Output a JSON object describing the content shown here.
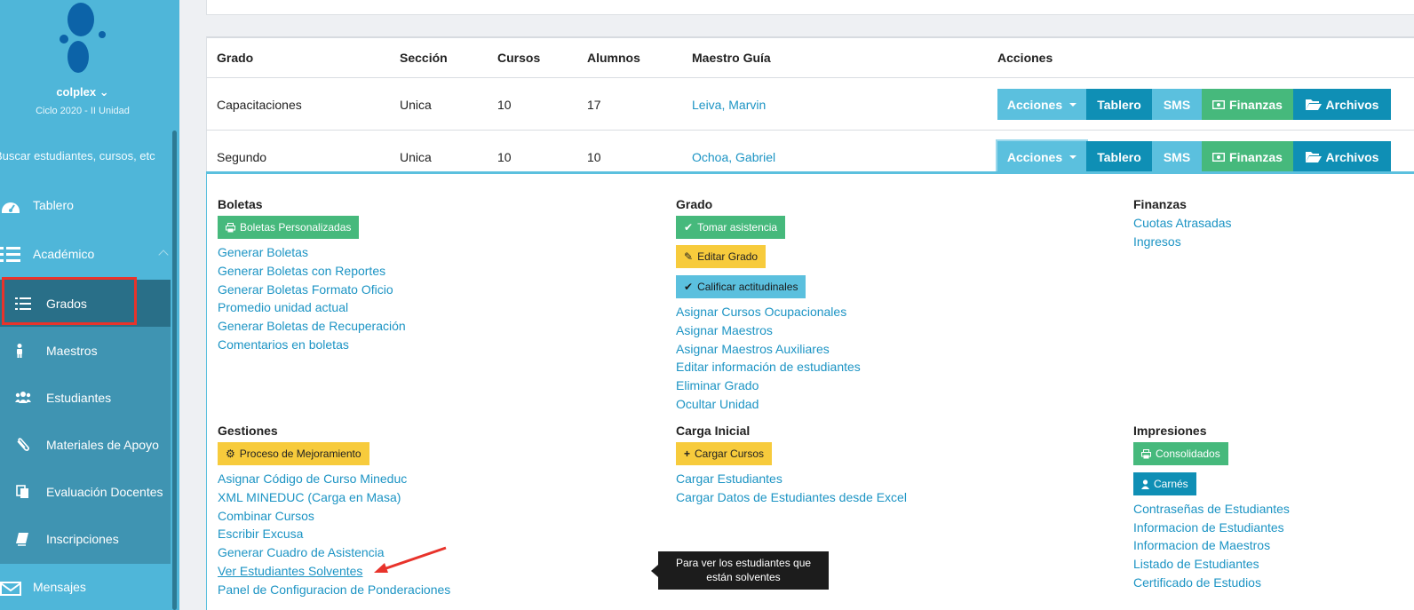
{
  "sidebar": {
    "brand": "colplex",
    "cycle": "Ciclo 2020 - II Unidad",
    "search_placeholder": "Buscar estudiantes, cursos, etc",
    "nav": {
      "tablero": "Tablero",
      "academico": "Académico",
      "mensajes": "Mensajes"
    },
    "sub": {
      "grados": "Grados",
      "maestros": "Maestros",
      "estudiantes": "Estudiantes",
      "materiales": "Materiales de Apoyo",
      "evaluacion": "Evaluación Docentes",
      "inscripciones": "Inscripciones"
    }
  },
  "table": {
    "headers": {
      "grado": "Grado",
      "seccion": "Sección",
      "cursos": "Cursos",
      "alumnos": "Alumnos",
      "maestro": "Maestro Guía",
      "acciones": "Acciones"
    },
    "rows": [
      {
        "grado": "Capacitaciones",
        "seccion": "Unica",
        "cursos": "10",
        "alumnos": "17",
        "maestro": "Leiva, Marvin"
      },
      {
        "grado": "Segundo",
        "seccion": "Unica",
        "cursos": "10",
        "alumnos": "10",
        "maestro": "Ochoa, Gabriel"
      }
    ],
    "buttons": {
      "acciones": "Acciones",
      "tablero": "Tablero",
      "sms": "SMS",
      "finanzas": "Finanzas",
      "archivos": "Archivos"
    }
  },
  "panel": {
    "boletas": {
      "title": "Boletas",
      "button": "Boletas Personalizadas",
      "links": [
        "Generar Boletas",
        "Generar Boletas con Reportes",
        "Generar Boletas Formato Oficio",
        "Promedio unidad actual",
        "Generar Boletas de Recuperación",
        "Comentarios en boletas"
      ]
    },
    "grado": {
      "title": "Grado",
      "btn_asistencia": "Tomar asistencia",
      "btn_editar": "Editar Grado",
      "btn_calificar": "Calificar actitudinales",
      "links": [
        "Asignar Cursos Ocupacionales",
        "Asignar Maestros",
        "Asignar Maestros Auxiliares",
        "Editar información de estudiantes",
        "Eliminar Grado",
        "Ocultar Unidad"
      ]
    },
    "finanzas": {
      "title": "Finanzas",
      "links": [
        "Cuotas Atrasadas",
        "Ingresos"
      ]
    },
    "gestiones": {
      "title": "Gestiones",
      "button": "Proceso de Mejoramiento",
      "links": [
        "Asignar Código de Curso Mineduc",
        "XML MINEDUC (Carga en Masa)",
        "Combinar Cursos",
        "Escribir Excusa",
        "Generar Cuadro de Asistencia",
        "Ver Estudiantes Solventes",
        "Panel de Configuracion de Ponderaciones"
      ]
    },
    "carga": {
      "title": "Carga Inicial",
      "button": "Cargar Cursos",
      "links": [
        "Cargar Estudiantes",
        "Cargar Datos de Estudiantes desde Excel"
      ]
    },
    "impresiones": {
      "title": "Impresiones",
      "btn_consolidados": "Consolidados",
      "btn_carnes": "Carnés",
      "links": [
        "Contraseñas de Estudiantes",
        "Informacion de Estudiantes",
        "Informacion de Maestros",
        "Listado de Estudiantes",
        "Certificado de Estudios"
      ]
    }
  },
  "tooltip": "Para ver los estudiantes que están solventes",
  "colors": {
    "sidebar": "#4fb6d9",
    "primary": "#0f8fb5",
    "info": "#5bc0de",
    "success": "#46b97c",
    "warning": "#f7cb3c",
    "annotation": "#e8332b"
  }
}
